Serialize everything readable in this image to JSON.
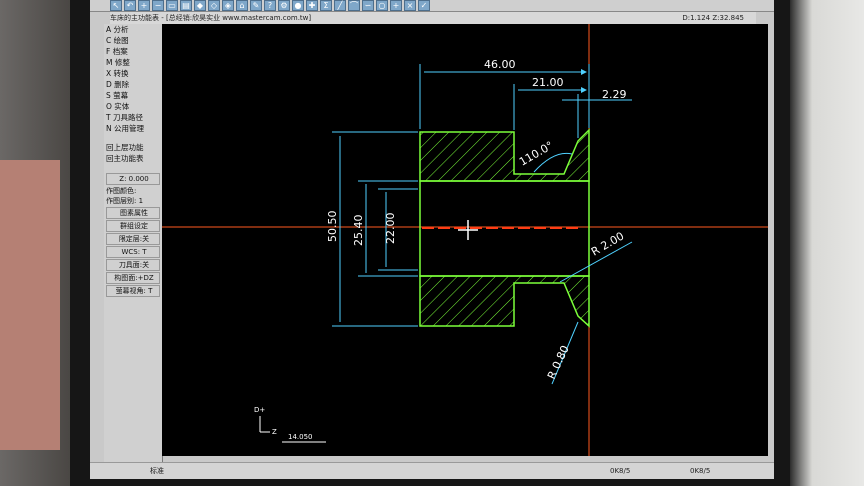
{
  "window": {
    "title": "车床的主功能表 - [总经销:欣昊实业 www.mastercam.com.tw]",
    "coords": "D:1.124  Z:32.845"
  },
  "toolbar": {
    "icons": [
      "arrow-icon",
      "undo-icon",
      "zoom-icon",
      "zoom-out-icon",
      "window-icon",
      "print-icon",
      "cube-icon",
      "view-icon",
      "view2-icon",
      "home-icon",
      "eraser-icon",
      "help-icon",
      "settings-icon",
      "sphere-icon",
      "tools-icon",
      "sum-icon",
      "line-icon",
      "arc-icon",
      "curve-icon",
      "circle-icon",
      "plus-icon",
      "ex-icon",
      "check-icon"
    ]
  },
  "menu": {
    "items": [
      {
        "label": "A 分析"
      },
      {
        "label": "C 绘图"
      },
      {
        "label": "F 档案"
      },
      {
        "label": "M 修整"
      },
      {
        "label": "X 转换"
      },
      {
        "label": "D 删除"
      },
      {
        "label": "S 萤幕"
      },
      {
        "label": "O 实体"
      },
      {
        "label": "T 刀具路径"
      },
      {
        "label": "N 公用管理"
      }
    ],
    "nav": [
      {
        "label": "回上层功能"
      },
      {
        "label": "回主功能表"
      }
    ],
    "status": [
      {
        "label": "Z: 0.000"
      },
      {
        "label": "作图颜色:"
      },
      {
        "label": "作图层别: 1"
      },
      {
        "label": "图素属性"
      },
      {
        "label": "群组设定"
      },
      {
        "label": "限定层:关"
      },
      {
        "label": "WCS: T"
      },
      {
        "label": "刀具面:关"
      },
      {
        "label": "构图面:+DZ"
      },
      {
        "label": "萤幕视角: T"
      }
    ]
  },
  "drawing": {
    "dims": {
      "d1": "46.00",
      "d2": "21.00",
      "d3": "2.29",
      "d4": "110.0°",
      "d5": "50.50",
      "d6": "25.40",
      "d7": "22.00",
      "d8": "R 2.00",
      "d9": "R 0.80"
    },
    "scale_label": "14.050",
    "axis_labels": {
      "d": "D+",
      "z": "Z"
    }
  },
  "bottombar": {
    "left_text": "标准",
    "right_text": "0K8/5",
    "tail_text": "0K8/5"
  },
  "colors": {
    "part": "#7cff3a",
    "dimension": "#4fd1ff",
    "centerline": "#ff5a1f",
    "background": "#000000"
  }
}
